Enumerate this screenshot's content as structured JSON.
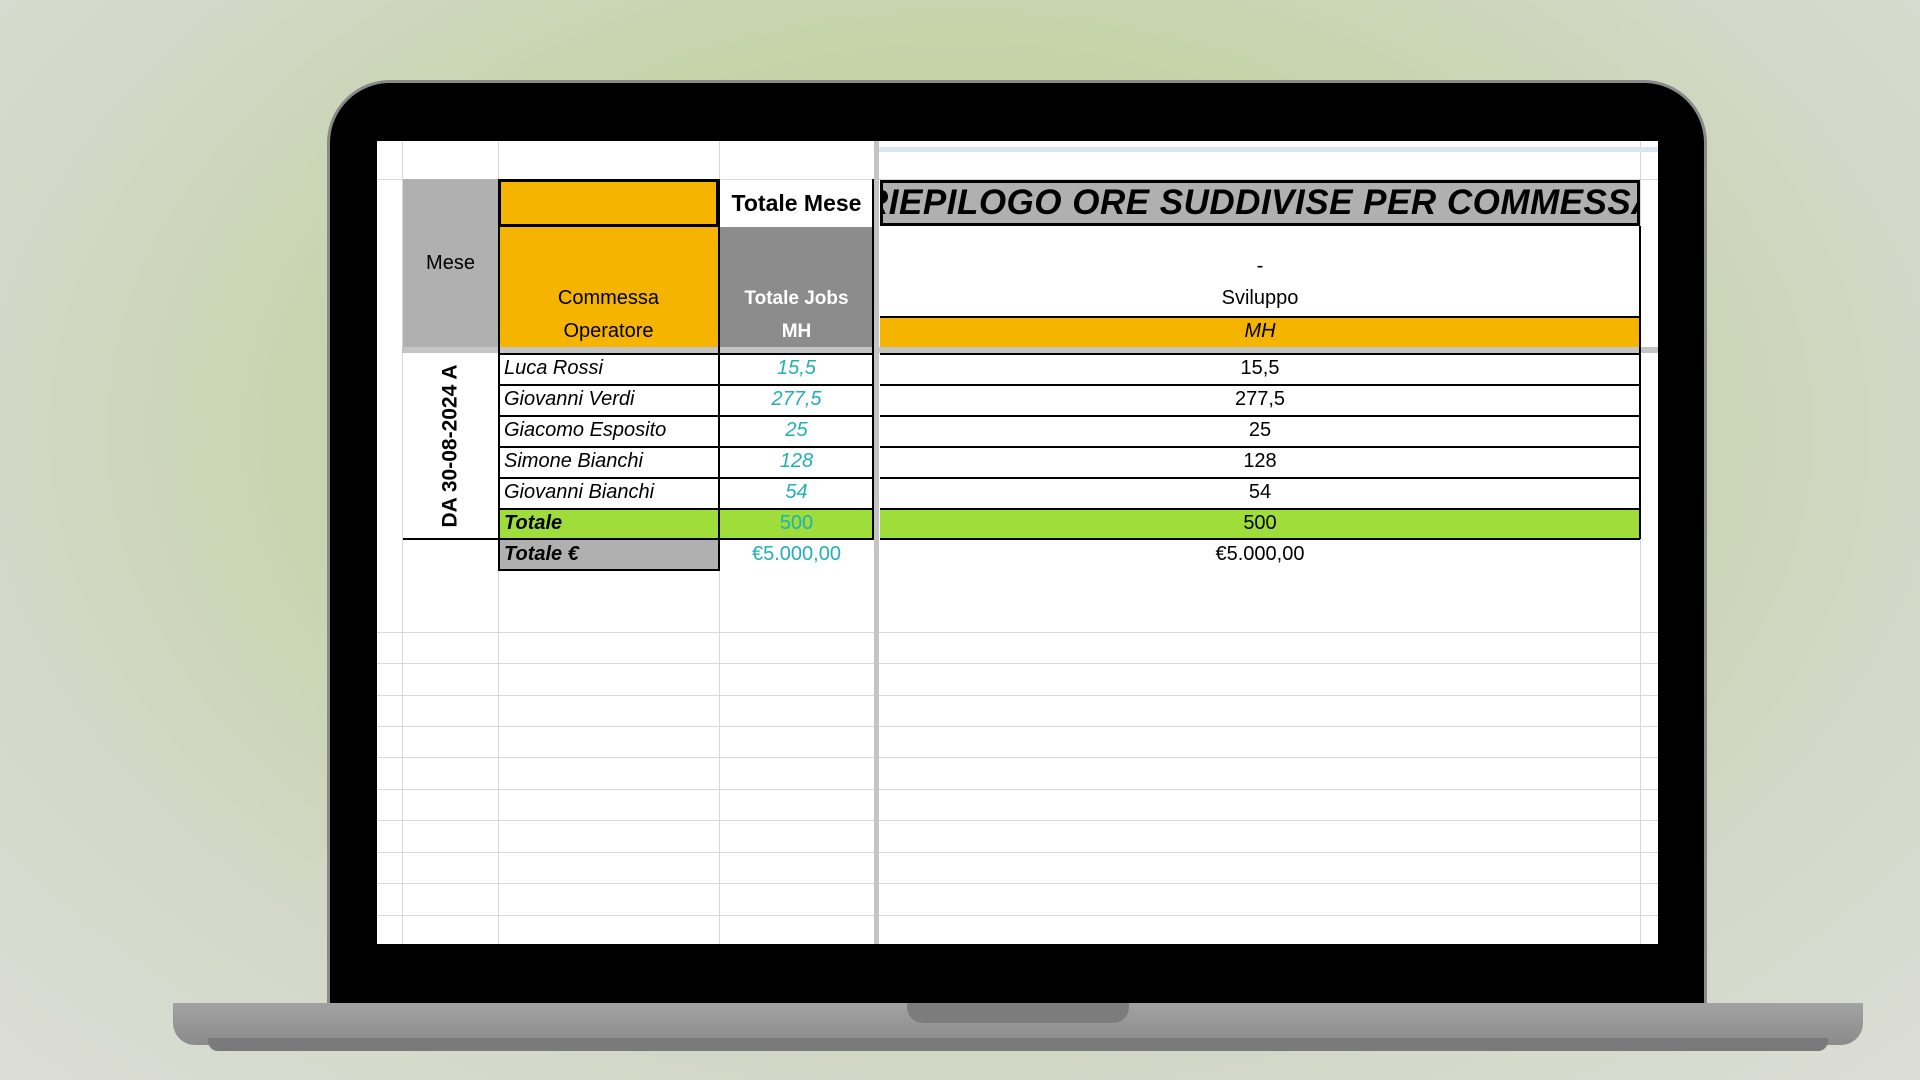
{
  "sheet": {
    "title_banner": "RIEPILOGO ORE SUDDIVISE PER COMMESSA",
    "totale_mese_label": "Totale Mese",
    "mese_label": "Mese",
    "commessa_label": "Commessa",
    "operatore_label": "Operatore",
    "totale_jobs_label": "Totale Jobs",
    "mh_label": "MH",
    "project_dash": "-",
    "project_name": "Sviluppo",
    "project_unit": "MH",
    "period_label": "DA 30-08-2024 A",
    "rows": [
      {
        "operator": "Luca Rossi",
        "total": "15,5",
        "project": "15,5"
      },
      {
        "operator": "Giovanni Verdi",
        "total": "277,5",
        "project": "277,5"
      },
      {
        "operator": "Giacomo Esposito",
        "total": "25",
        "project": "25"
      },
      {
        "operator": "Simone Bianchi",
        "total": "128",
        "project": "128"
      },
      {
        "operator": "Giovanni Bianchi",
        "total": "54",
        "project": "54"
      }
    ],
    "totale_label": "Totale",
    "totale_jobs": "500",
    "totale_project": "500",
    "totale_euro_label": "Totale €",
    "totale_euro_jobs": "€5.000,00",
    "totale_euro_project": "€5.000,00"
  },
  "colors": {
    "orange": "#f5b400",
    "gray_header": "#b0b0b0",
    "dark_gray_header": "#8c8c8c",
    "green_total": "#9fde3a",
    "teal_value": "#21b0b8"
  }
}
